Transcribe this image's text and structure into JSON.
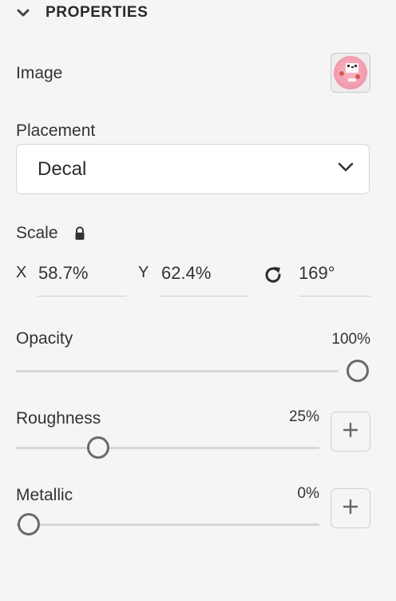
{
  "section": {
    "title": "PROPERTIES"
  },
  "image": {
    "label": "Image"
  },
  "placement": {
    "label": "Placement",
    "selected": "Decal"
  },
  "scale": {
    "label": "Scale",
    "x_label": "X",
    "x_value": "58.7%",
    "y_label": "Y",
    "y_value": "62.4%",
    "rotation_value": "169°",
    "locked": true
  },
  "opacity": {
    "label": "Opacity",
    "value_text": "100%",
    "value": 1.0
  },
  "roughness": {
    "label": "Roughness",
    "value_text": "25%",
    "value": 0.25
  },
  "metallic": {
    "label": "Metallic",
    "value_text": "0%",
    "value": 0.0
  },
  "icons": {
    "section_toggle": "chevron-down-icon",
    "lock": "lock-icon",
    "rotate": "rotate-icon",
    "dropdown": "chevron-down-icon",
    "add": "plus-icon"
  },
  "colors": {
    "background": "#f5f5f5",
    "knob_border": "#6a6a6a",
    "thumbnail_pink": "#f3a6b6"
  }
}
